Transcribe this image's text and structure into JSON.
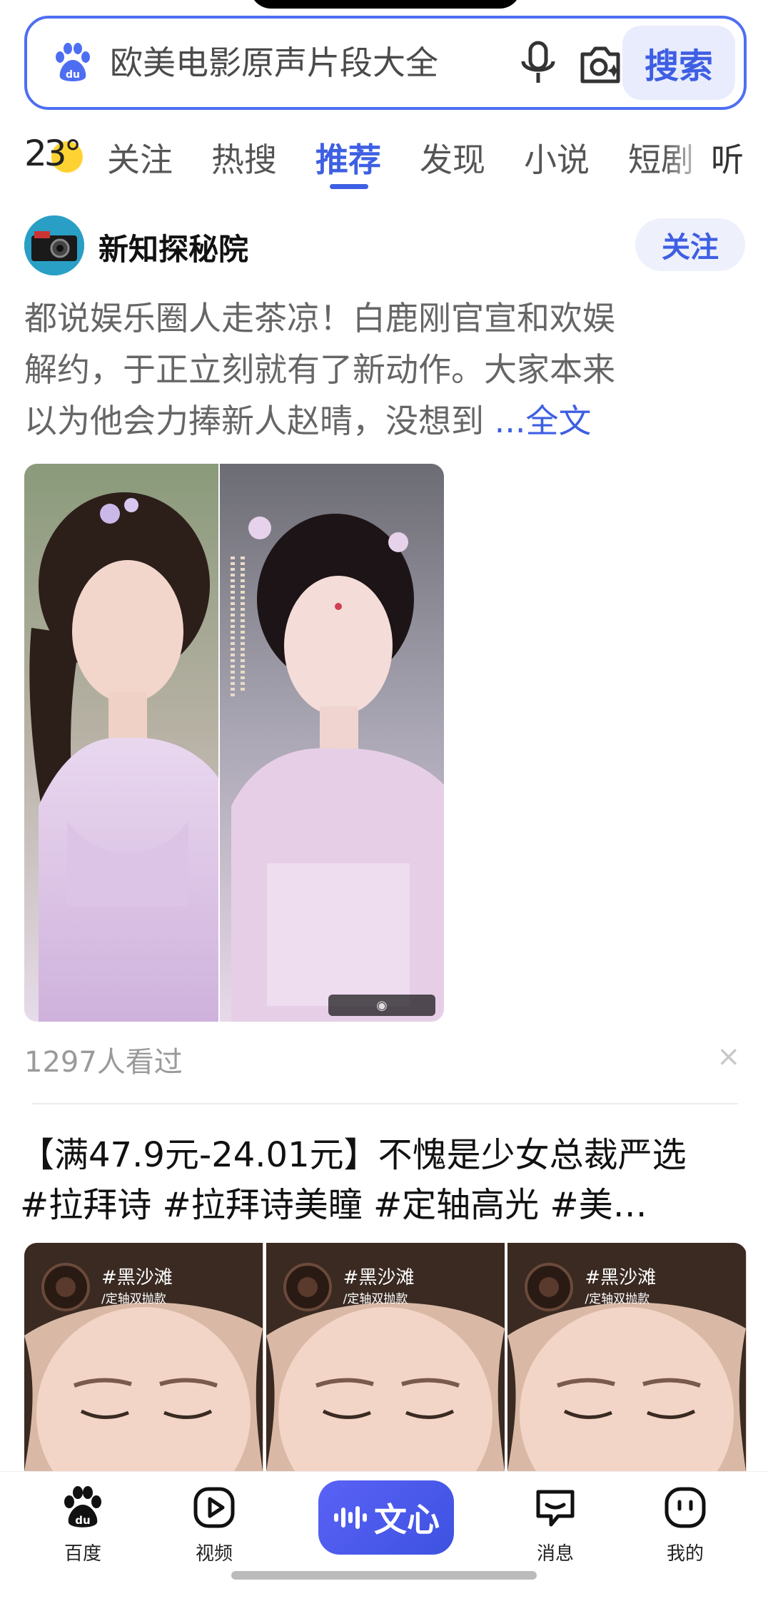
{
  "search": {
    "placeholder": "欧美电影原声片段大全",
    "button_label": "搜索"
  },
  "weather": {
    "temperature": "23°"
  },
  "tabs": [
    {
      "label": "关注",
      "active": false
    },
    {
      "label": "热搜",
      "active": false
    },
    {
      "label": "推荐",
      "active": true
    },
    {
      "label": "发现",
      "active": false
    },
    {
      "label": "小说",
      "active": false
    },
    {
      "label": "短剧",
      "active": false
    }
  ],
  "listen_label": "听",
  "post": {
    "author": "新知探秘院",
    "follow_label": "关注",
    "text_lines": [
      "都说娱乐圈人走茶凉！白鹿刚官宣和欢娱",
      "解约，于正立刻就有了新动作。大家本来",
      "以为他会力捧新人赵晴，没想到 "
    ],
    "full_text_label": "...全文",
    "view_count": "1297人看过",
    "dismiss_label": "×"
  },
  "ad": {
    "title_lines": [
      "【满47.9元-24.01元】不愧是少女总裁严选",
      "#拉拜诗 #拉拜诗美瞳 #定轴高光 #美…"
    ],
    "thumb_tag": "#黑沙滩",
    "thumb_sub": "/定轴双抛款"
  },
  "bottom_nav": {
    "home_label": "百度",
    "video_label": "视频",
    "wenxin_label": "文心",
    "messages_label": "消息",
    "profile_label": "我的"
  },
  "colors": {
    "accent": "#3e5fe3",
    "search_border": "#4e6ef2"
  }
}
